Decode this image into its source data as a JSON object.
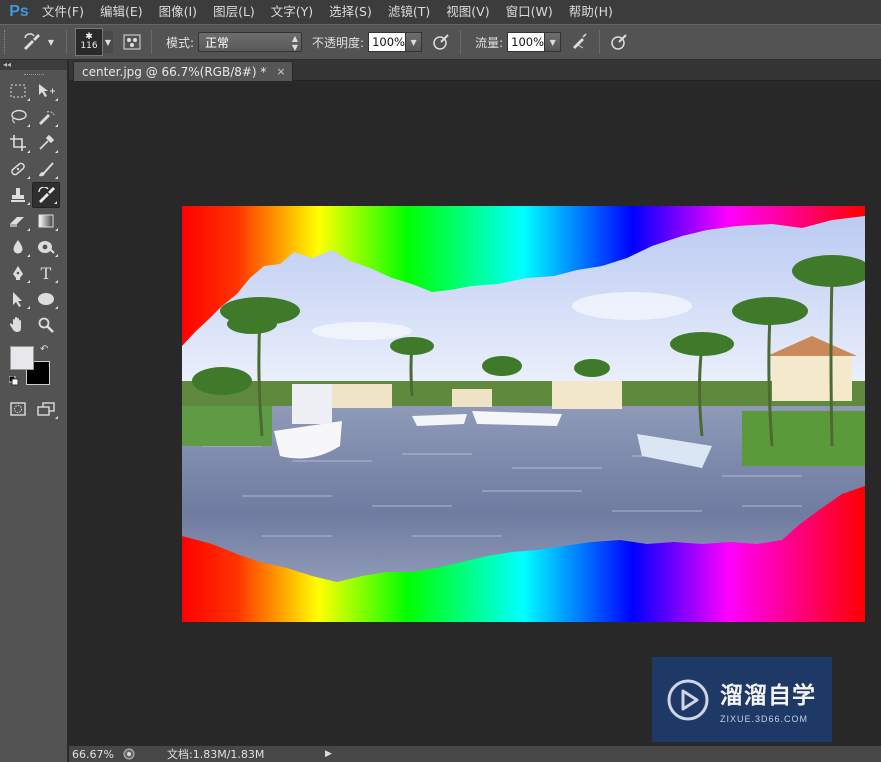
{
  "app": {
    "logo": "Ps"
  },
  "menu": [
    "文件(F)",
    "编辑(E)",
    "图像(I)",
    "图层(L)",
    "文字(Y)",
    "选择(S)",
    "滤镜(T)",
    "视图(V)",
    "窗口(W)",
    "帮助(H)"
  ],
  "options": {
    "brush_size": "116",
    "mode_label": "模式:",
    "mode_value": "正常",
    "opacity_label": "不透明度:",
    "opacity_value": "100%",
    "flow_label": "流量:",
    "flow_value": "100%"
  },
  "document": {
    "tab_title": "center.jpg @ 66.7%(RGB/8#) *",
    "close": "×"
  },
  "status": {
    "zoom": "66.67%",
    "doc_info": "文档:1.83M/1.83M"
  },
  "watermark": {
    "title": "溜溜自学",
    "subtitle": "ZIXUE.3D66.COM"
  },
  "tools": [
    [
      "marquee-icon",
      "move-icon"
    ],
    [
      "lasso-icon",
      "quick-select-icon"
    ],
    [
      "crop-icon",
      "eyedropper-icon"
    ],
    [
      "healing-brush-icon",
      "brush-icon"
    ],
    [
      "clone-stamp-icon",
      "history-brush-icon"
    ],
    [
      "eraser-icon",
      "gradient-icon"
    ],
    [
      "blur-icon",
      "dodge-icon"
    ],
    [
      "pen-icon",
      "type-icon"
    ],
    [
      "path-select-icon",
      "ellipse-shape-icon"
    ],
    [
      "hand-icon",
      "zoom-icon"
    ]
  ],
  "colors": {
    "foreground": "#e8e8ec",
    "background": "#000000",
    "accent": "#3d9ad8"
  }
}
